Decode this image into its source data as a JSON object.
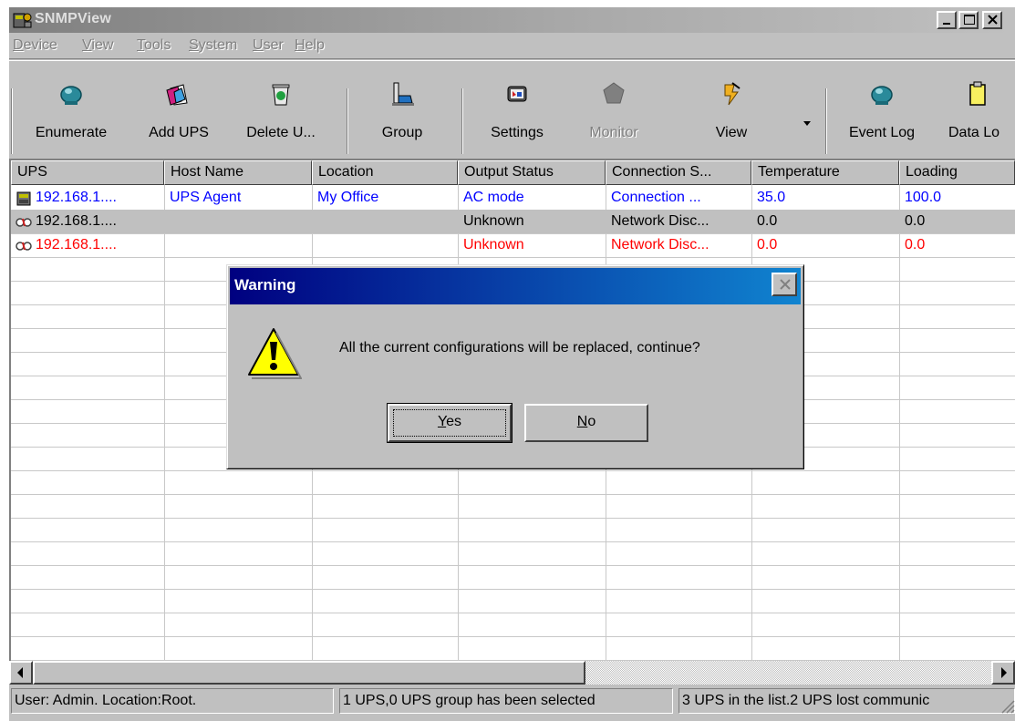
{
  "window": {
    "title": "SNMPView"
  },
  "menu": [
    {
      "label": "Device",
      "u": "D",
      "rest": "evice"
    },
    {
      "label": "View",
      "u": "V",
      "rest": "iew"
    },
    {
      "label": "Tools",
      "u": "T",
      "rest": "ools"
    },
    {
      "label": "System",
      "u": "S",
      "rest": "ystem"
    },
    {
      "label": "User",
      "u": "U",
      "rest": "ser"
    },
    {
      "label": "Help",
      "u": "H",
      "rest": "elp"
    }
  ],
  "toolbar": {
    "enumerate": "Enumerate",
    "add_ups": "Add UPS",
    "delete_ups": "Delete U...",
    "group": "Group",
    "settings": "Settings",
    "monitor": "Monitor",
    "view": "View",
    "event_log": "Event Log",
    "data_log": "Data Lo"
  },
  "columns": [
    "UPS",
    "Host Name",
    "Location",
    "Output Status",
    "Connection S...",
    "Temperature",
    "Loading"
  ],
  "rows": [
    {
      "ups": "192.168.1....",
      "host": "UPS Agent",
      "location": "My Office",
      "status": "AC mode",
      "connection": "Connection ...",
      "temperature": "35.0",
      "loading": "100.0",
      "color": "#0000ff",
      "icon": "ups-device-icon"
    },
    {
      "ups": "192.168.1....",
      "host": "",
      "location": "",
      "status": "Unknown",
      "connection": "Network Disc...",
      "temperature": "0.0",
      "loading": "0.0",
      "color": "#000000",
      "icon": "disconnected-icon"
    },
    {
      "ups": "192.168.1....",
      "host": "",
      "location": "",
      "status": "Unknown",
      "connection": "Network Disc...",
      "temperature": "0.0",
      "loading": "0.0",
      "color": "#ff0000",
      "icon": "disconnected-icon"
    }
  ],
  "status": {
    "user": "User: Admin.  Location:Root.",
    "selection": "1 UPS,0 UPS group has been selected",
    "summary": "3 UPS in the list.2 UPS  lost communic"
  },
  "dialog": {
    "title": "Warning",
    "message": "All the current configurations will be replaced, continue?",
    "yes_u": "Y",
    "yes_rest": "es",
    "no_u": "N",
    "no_rest": "o"
  },
  "colors": {
    "online": "#0000ff",
    "offline": "#ff0000",
    "dialog_title": "#000080"
  }
}
